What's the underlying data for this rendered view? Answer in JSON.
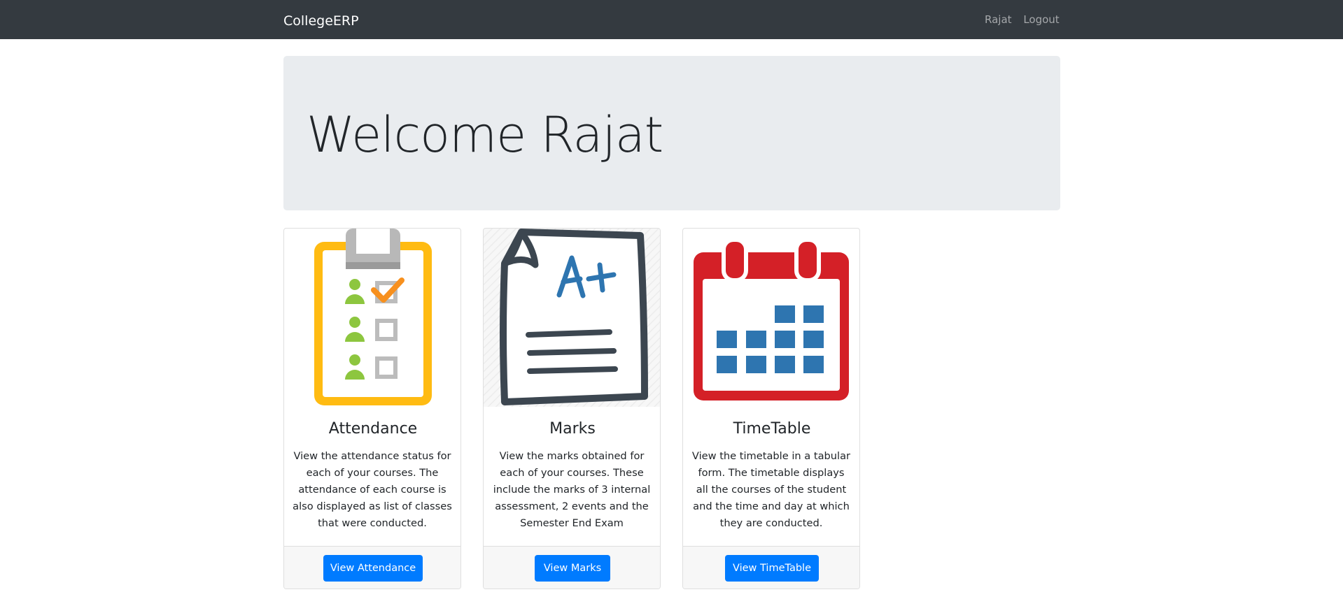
{
  "navbar": {
    "brand": "CollegeERP",
    "user_link": "Rajat",
    "logout_link": "Logout"
  },
  "jumbotron": {
    "title": "Welcome Rajat"
  },
  "cards": [
    {
      "title": "Attendance",
      "text": "View the attendance status for each of your courses. The attendance of each course is also displayed as list of classes that were conducted.",
      "button": "View Attendance",
      "icon": "attendance-clipboard-icon"
    },
    {
      "title": "Marks",
      "text": "View the marks obtained for each of your courses. These include the marks of 3 internal assessment, 2 events and the Semester End Exam",
      "button": "View Marks",
      "icon": "marks-paper-icon"
    },
    {
      "title": "TimeTable",
      "text": "View the timetable in a tabular form. The timetable displays all the courses of the student and the time and day at which they are conducted.",
      "button": "View TimeTable",
      "icon": "calendar-icon"
    }
  ],
  "colors": {
    "navbar_bg": "#343a40",
    "jumbotron_bg": "#e9ecef",
    "primary": "#007bff",
    "clipboard_yellow": "#ffbb12",
    "calendar_red": "#d42027",
    "calendar_blue": "#2e75b0",
    "check_orange": "#f7901e",
    "person_green": "#8dc63f"
  }
}
